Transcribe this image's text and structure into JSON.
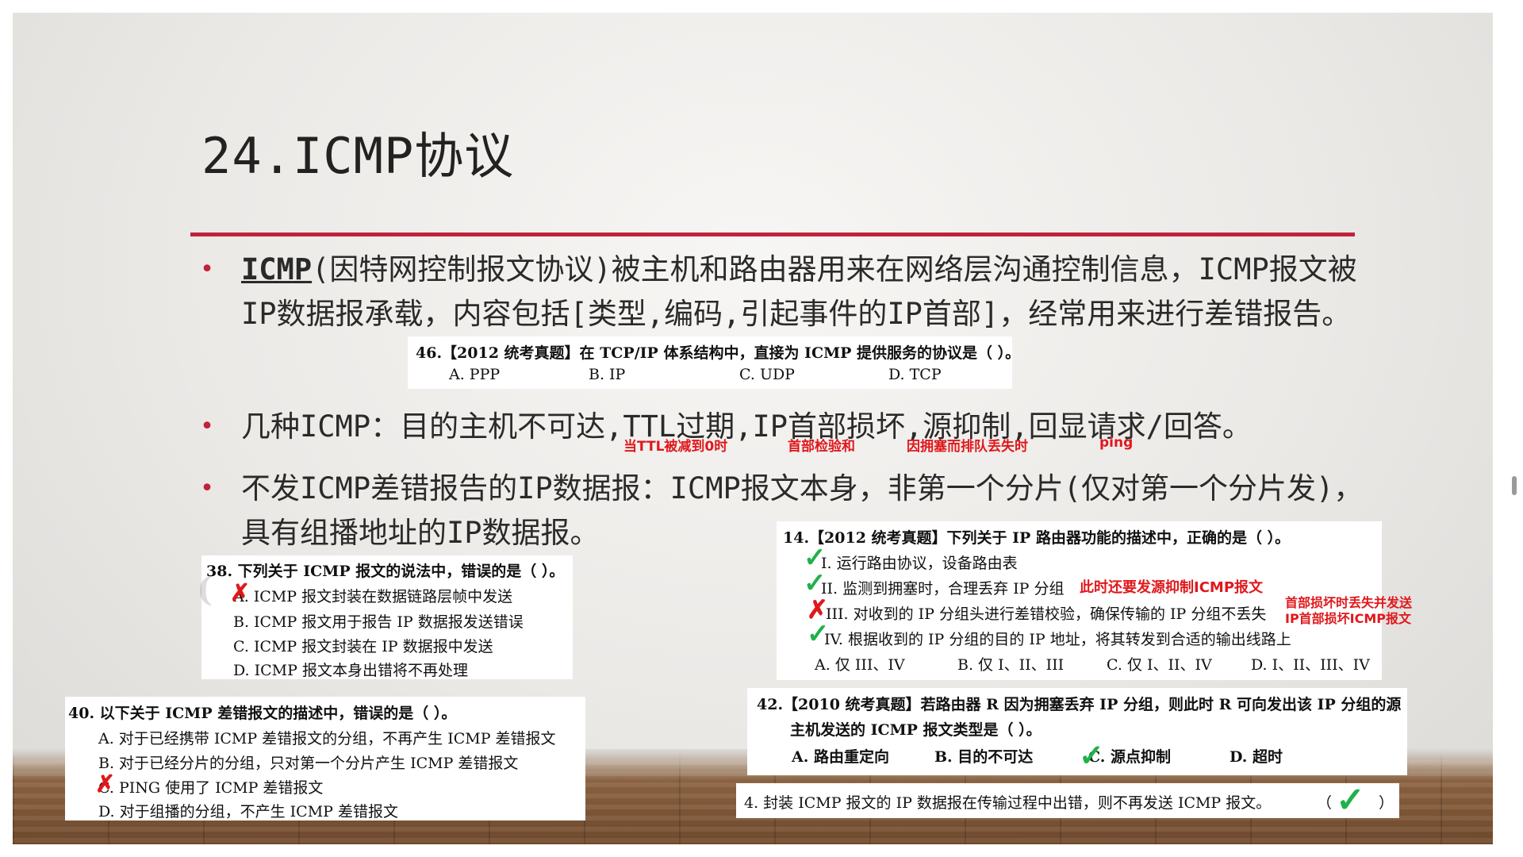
{
  "slide": {
    "title": "24.ICMP协议",
    "accent_color": "#c0223a",
    "bullets": [
      {
        "lead": "ICMP",
        "text": "(因特网控制报文协议)被主机和路由器用来在网络层沟通控制信息，ICMP报文被IP数据报承载，内容包括[类型,编码,引起事件的IP首部]，经常用来进行差错报告。"
      },
      {
        "text": "几种ICMP：目的主机不可达,TTL过期,IP首部损坏,源抑制,回显请求/回答。"
      },
      {
        "text": "不发ICMP差错报告的IP数据报：ICMP报文本身，非第一个分片(仅对第一个分片发)，具有组播地址的IP数据报。"
      }
    ],
    "annotations": [
      "当TTL被减到0时",
      "首部检验和",
      "因拥塞而排队丢失时",
      "ping"
    ]
  },
  "q46": {
    "stem": "46.【2012 统考真题】在 TCP/IP 体系结构中，直接为 ICMP 提供服务的协议是（   ）。",
    "options": [
      "A.  PPP",
      "B.  IP",
      "C.  UDP",
      "D.  TCP"
    ]
  },
  "q38": {
    "stem": "38.  下列关于 ICMP 报文的说法中，错误的是（   ）。",
    "options": [
      "A.  ICMP 报文封装在数据链路层帧中发送",
      "B.  ICMP 报文用于报告 IP 数据报发送错误",
      "C.  ICMP 报文封装在 IP 数据报中发送",
      "D.  ICMP 报文本身出错将不再处理"
    ]
  },
  "q40": {
    "stem": "40.  以下关于 ICMP 差错报文的描述中，错误的是（   ）。",
    "options": [
      "A.  对于已经携带 ICMP 差错报文的分组，不再产生 ICMP 差错报文",
      "B.  对于已经分片的分组，只对第一个分片产生 ICMP 差错报文",
      "C.  PING 使用了 ICMP 差错报文",
      "D.  对于组播的分组，不产生 ICMP 差错报文"
    ]
  },
  "q14": {
    "stem": "14.【2012 统考真题】下列关于 IP 路由器功能的描述中，正确的是（   ）。",
    "items": [
      "I.  运行路由协议，设备路由表",
      "II.  监测到拥塞时，合理丢弃 IP 分组",
      "III.  对收到的 IP 分组头进行差错校验，确保传输的 IP 分组不丢失",
      "IV.  根据收到的 IP 分组的目的 IP 地址，将其转发到合适的输出线路上"
    ],
    "options": [
      "A.  仅 III、IV",
      "B.  仅 I、II、III",
      "C.  仅 I、II、IV",
      "D.  I、II、III、IV"
    ],
    "note_ii": "此时还要发源抑制ICMP报文",
    "note_iii_1": "首部损坏时丢失并发送",
    "note_iii_2": "IP首部损坏ICMP报文"
  },
  "q42": {
    "stem1": "42.【2010 统考真题】若路由器 R 因为拥塞丢弃 IP 分组，则此时 R 可向发出该 IP 分组的源",
    "stem2": "主机发送的 ICMP 报文类型是（   ）。",
    "options": [
      "A.  路由重定向",
      "B.  目的不可达",
      "C.  源点抑制",
      "D.  超时"
    ]
  },
  "q4": {
    "stem": "4. 封装 ICMP 报文的 IP 数据报在传输过程中出错，则不再发送 ICMP 报文。",
    "paren_open": "（",
    "paren_close": "）"
  },
  "marks": {
    "check": "✓",
    "cross": "✗"
  }
}
